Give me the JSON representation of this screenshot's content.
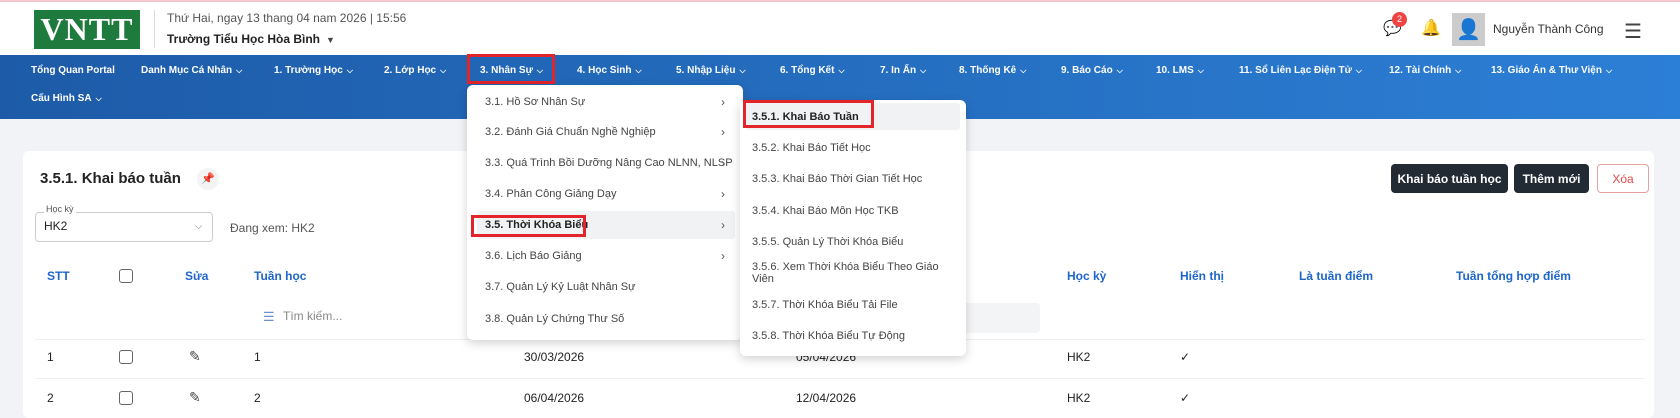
{
  "header": {
    "logo": "VNTT",
    "date": "Thứ Hai, ngay 13 thang 04 nam 2026 | 15:56",
    "school": "Trường Tiểu Học Hòa Bình",
    "notif_count": "2",
    "user": "Nguyễn Thành Công"
  },
  "nav": [
    {
      "label": "Tổng Quan Portal"
    },
    {
      "label": "Danh Mục Cá Nhân"
    },
    {
      "label": "1. Trường Học"
    },
    {
      "label": "2. Lớp Học"
    },
    {
      "label": "3. Nhân Sự"
    },
    {
      "label": "4. Học Sinh"
    },
    {
      "label": "5. Nhập Liệu"
    },
    {
      "label": "6. Tổng Kết"
    },
    {
      "label": "7. In Ấn"
    },
    {
      "label": "8. Thống Kê"
    },
    {
      "label": "9. Báo Cáo"
    },
    {
      "label": "10. LMS"
    },
    {
      "label": "11. Sổ Liên Lạc Điện Tử"
    },
    {
      "label": "12. Tài Chính"
    },
    {
      "label": "13. Giáo Án & Thư Viện"
    },
    {
      "label": "Cấu Hình SA"
    }
  ],
  "page": {
    "title": "3.5.1. Khai báo tuần",
    "btn_declare": "Khai báo tuần học",
    "btn_add": "Thêm mới",
    "btn_delete": "Xóa",
    "semester_label": "Học kỳ",
    "semester_value": "HK2",
    "viewing": "Đang xem: HK2",
    "search_placeholder": "Tìm kiếm..."
  },
  "table": {
    "headers": {
      "stt": "STT",
      "edit": "Sửa",
      "week": "Tuần học",
      "semester": "Học kỳ",
      "visible": "Hiển thị",
      "score_week": "Là tuần điểm",
      "summary_week": "Tuần tổng hợp điểm"
    },
    "rows": [
      {
        "stt": "1",
        "week": "1",
        "start": "30/03/2026",
        "end": "05/04/2026",
        "semester": "HK2",
        "visible": "✓"
      },
      {
        "stt": "2",
        "week": "2",
        "start": "06/04/2026",
        "end": "12/04/2026",
        "semester": "HK2",
        "visible": "✓"
      }
    ]
  },
  "dropdown1": [
    {
      "label": "3.1. Hồ Sơ Nhân Sự",
      "arrow": "›"
    },
    {
      "label": "3.2. Đánh Giá Chuẩn Nghề Nghiệp",
      "arrow": "›"
    },
    {
      "label": "3.3. Quá Trình Bồi Dưỡng Nâng Cao NLNN, NLSP",
      "arrow": "›"
    },
    {
      "label": "3.4. Phân Công Giảng Dạy",
      "arrow": "›"
    },
    {
      "label": "3.5. Thời Khóa Biểu",
      "arrow": "›"
    },
    {
      "label": "3.6. Lịch Báo Giảng",
      "arrow": "›"
    },
    {
      "label": "3.7. Quản Lý Kỷ Luật Nhân Sự",
      "arrow": ""
    },
    {
      "label": "3.8. Quản Lý Chứng Thư Số",
      "arrow": ""
    }
  ],
  "dropdown2": [
    {
      "label": "3.5.1. Khai Báo Tuần"
    },
    {
      "label": "3.5.2. Khai Báo Tiết Học"
    },
    {
      "label": "3.5.3. Khai Báo Thời Gian Tiết Học"
    },
    {
      "label": "3.5.4. Khai Báo Môn Học TKB"
    },
    {
      "label": "3.5.5. Quản Lý Thời Khóa Biểu"
    },
    {
      "label": "3.5.6. Xem Thời Khóa Biểu Theo Giáo Viên"
    },
    {
      "label": "3.5.7. Thời Khóa Biểu Tải File"
    },
    {
      "label": "3.5.8. Thời Khóa Biểu Tự Động"
    }
  ]
}
